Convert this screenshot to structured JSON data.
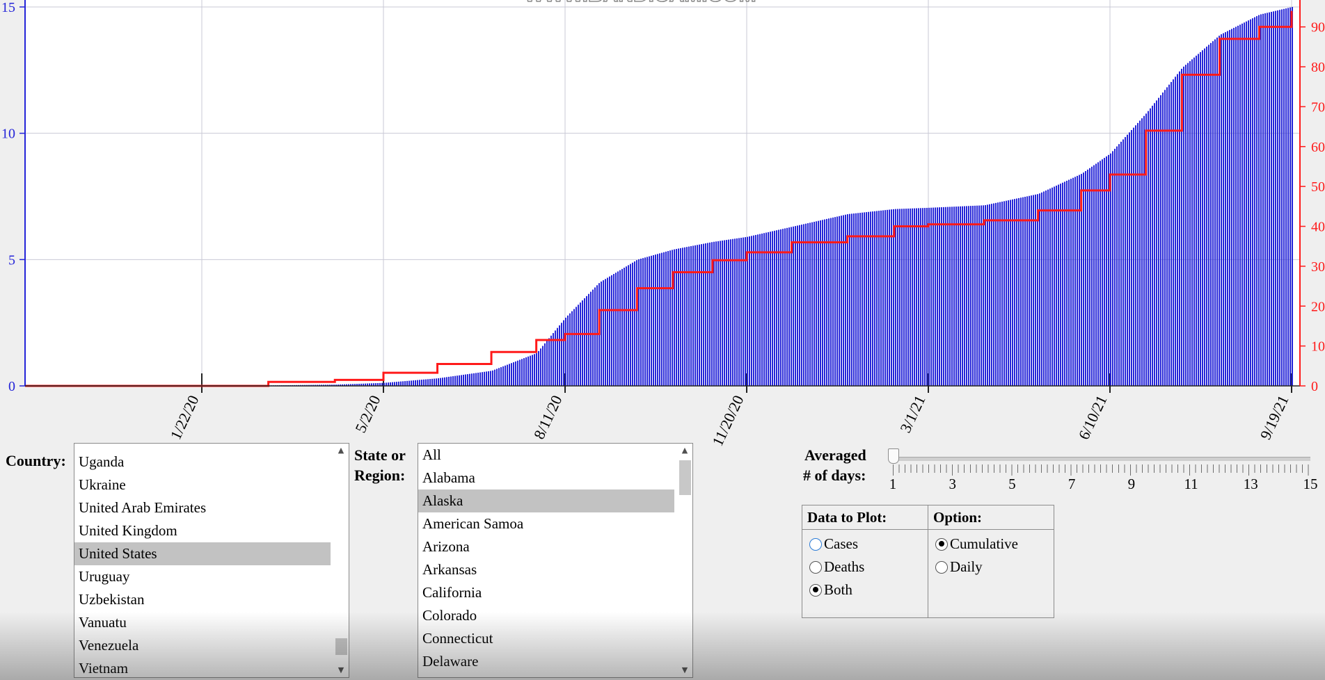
{
  "chart_data": {
    "type": "bar",
    "title": "",
    "x_tick_labels": [
      "1/22/20",
      "5/2/20",
      "8/11/20",
      "11/20/20",
      "3/1/21",
      "6/10/21",
      "9/19/21"
    ],
    "left_axis": {
      "ticks": [
        "0",
        "5",
        "10",
        "15"
      ],
      "ylim": [
        0,
        15
      ],
      "color": "#2424d8"
    },
    "right_axis": {
      "ticks": [
        "0",
        "10",
        "20",
        "30",
        "40",
        "50",
        "60",
        "70",
        "80",
        "90"
      ],
      "ylim": [
        0,
        95
      ],
      "color": "#ff1a1a"
    },
    "grid": true,
    "series": [
      {
        "kind": "bar",
        "axis": "left",
        "color": "#2424d8",
        "x": [
          "1/22/20",
          "2/28/20",
          "4/5/20",
          "5/2/20",
          "6/1/20",
          "7/1/20",
          "7/26/20",
          "8/11/20",
          "8/30/20",
          "9/20/20",
          "10/10/20",
          "11/1/20",
          "11/20/20",
          "12/15/20",
          "1/15/21",
          "2/10/21",
          "3/1/21",
          "4/1/21",
          "5/1/21",
          "5/25/21",
          "6/10/21",
          "6/30/21",
          "7/20/21",
          "8/10/21",
          "9/1/21",
          "9/19/21"
        ],
        "values": [
          0,
          0.02,
          0.05,
          0.12,
          0.3,
          0.6,
          1.3,
          2.7,
          4.1,
          5.0,
          5.4,
          5.7,
          5.9,
          6.3,
          6.8,
          7.0,
          7.05,
          7.15,
          7.6,
          8.4,
          9.2,
          10.8,
          12.6,
          13.9,
          14.7,
          15.0
        ]
      },
      {
        "kind": "line",
        "axis": "right",
        "color": "#ff1a1a",
        "x": [
          "1/22/20",
          "2/28/20",
          "4/5/20",
          "5/2/20",
          "6/1/20",
          "7/1/20",
          "7/26/20",
          "8/11/20",
          "8/30/20",
          "9/20/20",
          "10/10/20",
          "11/1/20",
          "11/20/20",
          "12/15/20",
          "1/15/21",
          "2/10/21",
          "3/1/21",
          "4/1/21",
          "5/1/21",
          "5/25/21",
          "6/10/21",
          "6/30/21",
          "7/20/21",
          "8/10/21",
          "9/1/21",
          "9/19/21"
        ],
        "values": [
          0,
          1,
          1.5,
          3.3,
          5.5,
          8.5,
          11.5,
          13,
          19,
          24.5,
          28.5,
          31.5,
          33.5,
          36,
          37.5,
          40,
          40.5,
          41.5,
          44,
          49,
          53,
          64,
          78,
          87,
          90,
          94
        ]
      }
    ]
  },
  "watermark": "WWW.BANDICAM.COM",
  "country": {
    "label": "Country:",
    "items": [
      "Uganda",
      "Ukraine",
      "United Arab Emirates",
      "United Kingdom",
      "United States",
      "Uruguay",
      "Uzbekistan",
      "Vanuatu",
      "Venezuela",
      "Vietnam"
    ],
    "selected": "United States"
  },
  "region": {
    "label_line1": "State or",
    "label_line2": "Region:",
    "items": [
      "All",
      "Alabama",
      "Alaska",
      "American Samoa",
      "Arizona",
      "Arkansas",
      "California",
      "Colorado",
      "Connecticut",
      "Delaware"
    ],
    "selected": "Alaska"
  },
  "averaging": {
    "label_line1": "Averaged",
    "label_line2": "# of days:",
    "value": 1,
    "min": 1,
    "max": 15,
    "tick_labels": [
      "1",
      "3",
      "5",
      "7",
      "9",
      "11",
      "13",
      "15"
    ]
  },
  "data_to_plot": {
    "header": "Data to Plot:",
    "options": [
      "Cases",
      "Deaths",
      "Both"
    ],
    "selected": "Both"
  },
  "option": {
    "header": "Option:",
    "options": [
      "Cumulative",
      "Daily"
    ],
    "selected": "Cumulative"
  },
  "icons": {
    "scroll_up": "scroll-up-arrow-icon",
    "scroll_down": "scroll-down-arrow-icon"
  }
}
